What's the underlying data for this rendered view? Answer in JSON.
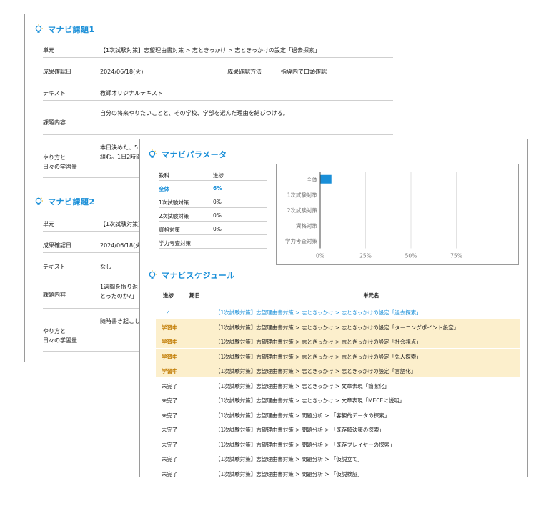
{
  "task1": {
    "title": "マナビ課題1",
    "rows": [
      {
        "label": "単元",
        "value": "【1次試験対策】志望理由書対策 > 志ときっかけ > 志ときっかけの設定「過去探索」"
      },
      {
        "label": "成果確認日",
        "value": "2024/06/18(火)",
        "label2": "成果確認方法",
        "value2": "指導内で口頭確認"
      },
      {
        "label": "テキスト",
        "value": "教師オリジナルテキスト"
      },
      {
        "label": "課題内容",
        "value": "自分の将来やりたいことと、その学校、学部を選んだ理由を結びつける。"
      },
      {
        "label": "やり方と\n日々の学習量",
        "value": "本日決めた、5つ\n組む。1日2時間"
      }
    ]
  },
  "task2": {
    "title": "マナビ課題2",
    "rows": [
      {
        "label": "単元",
        "value": "【1次試験対策】"
      },
      {
        "label": "成果確認日",
        "value": "2024/06/18(火)"
      },
      {
        "label": "テキスト",
        "value": "なし"
      },
      {
        "label": "課題内容",
        "value": "1週間を振り返っ\nとったのか?」"
      },
      {
        "label": "やり方と\n日々の学習量",
        "value": "随時書き起こし"
      }
    ]
  },
  "params": {
    "title": "マナビパラメータ",
    "header": {
      "subject": "教科",
      "progress": "進捗"
    },
    "rows": [
      {
        "subject": "全体",
        "progress": "6%",
        "highlight": true
      },
      {
        "subject": "1次試験対策",
        "progress": "0%"
      },
      {
        "subject": "2次試験対策",
        "progress": "0%"
      },
      {
        "subject": "資格対策",
        "progress": "0%"
      },
      {
        "subject": "学力考査対策",
        "progress": ""
      }
    ]
  },
  "chart_data": {
    "type": "bar",
    "orientation": "horizontal",
    "categories": [
      "全体",
      "1次試験対策",
      "2次試験対策",
      "資格対策",
      "学力考査対策"
    ],
    "values": [
      6,
      0,
      0,
      0,
      0
    ],
    "xticks": [
      "0%",
      "25%",
      "50%",
      "75%"
    ],
    "xlim": [
      0,
      100
    ],
    "grid": true,
    "bar_color": "#1a8fd8"
  },
  "schedule": {
    "title": "マナビスケジュール",
    "header": {
      "status": "進捗",
      "date": "期日",
      "unit": "単元名"
    },
    "rows": [
      {
        "status": "✓",
        "state": "done",
        "unit": "【1次試験対策】志望理由書対策 > 志ときっかけ > 志ときっかけの設定「過去探索」"
      },
      {
        "status": "学習中",
        "state": "active",
        "unit": "【1次試験対策】志望理由書対策 > 志ときっかけ > 志ときっかけの設定「ターニングポイント設定」"
      },
      {
        "status": "学習中",
        "state": "active",
        "unit": "【1次試験対策】志望理由書対策 > 志ときっかけ > 志ときっかけの設定「社会視点」"
      },
      {
        "status": "学習中",
        "state": "active",
        "unit": "【1次試験対策】志望理由書対策 > 志ときっかけ > 志ときっかけの設定「先人探索」"
      },
      {
        "status": "学習中",
        "state": "active",
        "unit": "【1次試験対策】志望理由書対策 > 志ときっかけ > 志ときっかけの設定「言語化」"
      },
      {
        "status": "未完了",
        "state": "todo",
        "unit": "【1次試験対策】志望理由書対策 > 志ときっかけ > 文章表現「簡潔化」"
      },
      {
        "status": "未完了",
        "state": "todo",
        "unit": "【1次試験対策】志望理由書対策 > 志ときっかけ > 文章表現「MECEに説明」"
      },
      {
        "status": "未完了",
        "state": "todo",
        "unit": "【1次試験対策】志望理由書対策 > 問題分析 > 「客観的データの探索」"
      },
      {
        "status": "未完了",
        "state": "todo",
        "unit": "【1次試験対策】志望理由書対策 > 問題分析 > 「既存解決策の探索」"
      },
      {
        "status": "未完了",
        "state": "todo",
        "unit": "【1次試験対策】志望理由書対策 > 問題分析 > 「既存プレイヤーの探索」"
      },
      {
        "status": "未完了",
        "state": "todo",
        "unit": "【1次試験対策】志望理由書対策 > 問題分析 > 「仮説立て」"
      },
      {
        "status": "未完了",
        "state": "todo",
        "unit": "【1次試験対策】志望理由書対策 > 問題分析 > 「仮説検証」"
      }
    ]
  },
  "icons": {
    "section": "lightbulb-icon"
  },
  "colors": {
    "accent": "#1a8fd8",
    "active_bg": "#fcefcc",
    "active_text": "#c07a00"
  }
}
